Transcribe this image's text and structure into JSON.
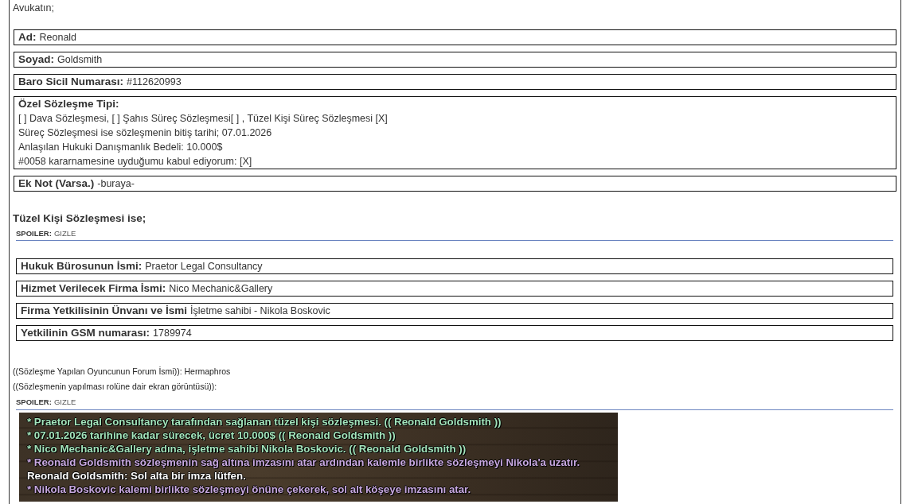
{
  "intro": "Avukatın;",
  "lawyer_fields": [
    {
      "kind": "inline",
      "label": "Ad:",
      "value": "Reonald"
    },
    {
      "kind": "inline",
      "label": "Soyad:",
      "value": "Goldsmith"
    },
    {
      "kind": "inline",
      "label": "Baro Sicil Numarası:",
      "value": "#112620993"
    },
    {
      "kind": "block",
      "label": "Özel Sözleşme Tipi:",
      "lines": [
        "[ ] Dava Sözleşmesi, [ ] Şahıs Süreç Sözleşmesi[ ] , Tüzel Kişi Süreç Sözleşmesi [X]",
        "Süreç Sözleşmesi ise sözleşmenin bitiş tarihi; 07.01.2026",
        "Anlaşılan Hukuki Danışmanlık Bedeli: 10.000$",
        "#0058 kararnamesine uyduğumu kabul ediyorum: [X]"
      ]
    },
    {
      "kind": "inline",
      "label": "Ek Not (Varsa.)",
      "value": "-buraya-"
    }
  ],
  "corporate_section": {
    "heading": "Tüzel Kişi Sözleşmesi ise;",
    "spoiler": {
      "label": "SPOILER:",
      "toggle": "GIZLE"
    },
    "fields": [
      {
        "label": "Hukuk Bürosunun İsmi:",
        "value": "Praetor Legal Consultancy"
      },
      {
        "label": "Hizmet Verilecek Firma İsmi:",
        "value": "Nico Mechanic&Gallery"
      },
      {
        "label": "Firma Yetkilisinin Ünvanı ve İsmi",
        "value": "İşletme sahibi - Nikola Boskovic"
      },
      {
        "label": "Yetkilinin GSM numarası:",
        "value": "1789974"
      }
    ]
  },
  "forum_lines": [
    "((Sözleşme Yapılan Oyuncunun Forum İsmi)): Hermaphros",
    "((Sözleşmenin yapılması rolüne dair ekran görüntüsü)):"
  ],
  "screenshot_spoiler": {
    "label": "SPOILER:",
    "toggle": "GIZLE",
    "chat_lines": [
      {
        "text": "* Praetor Legal Consultancy tarafından sağlanan tüzel kişi sözleşmesi. (( Reonald Goldsmith ))",
        "color": "#a3e4bb"
      },
      {
        "text": "* 07.01.2026 tarihine kadar sürecek, ücret 10.000$ (( Reonald Goldsmith ))",
        "color": "#a3e4bb"
      },
      {
        "text": "* Nico Mechanic&Gallery adına, işletme sahibi Nikola Boskovic. (( Reonald Goldsmith ))",
        "color": "#a3e4bb"
      },
      {
        "text": "* Reonald Goldsmith sözleşmenin sağ altına imzasını atar ardından kalemle birlikte sözleşmeyi Nikola'a uzatır.",
        "color": "#c8a8e0"
      },
      {
        "text": "Reonald Goldsmith: Sol alta bir imza lütfen.",
        "color": "#ffffff"
      },
      {
        "text": "* Nikola Boskovic kalemi birlikte sözleşmeyi önüne çekerek, sol alt köşeye imzasını atar.",
        "color": "#c8a8e0"
      }
    ]
  }
}
